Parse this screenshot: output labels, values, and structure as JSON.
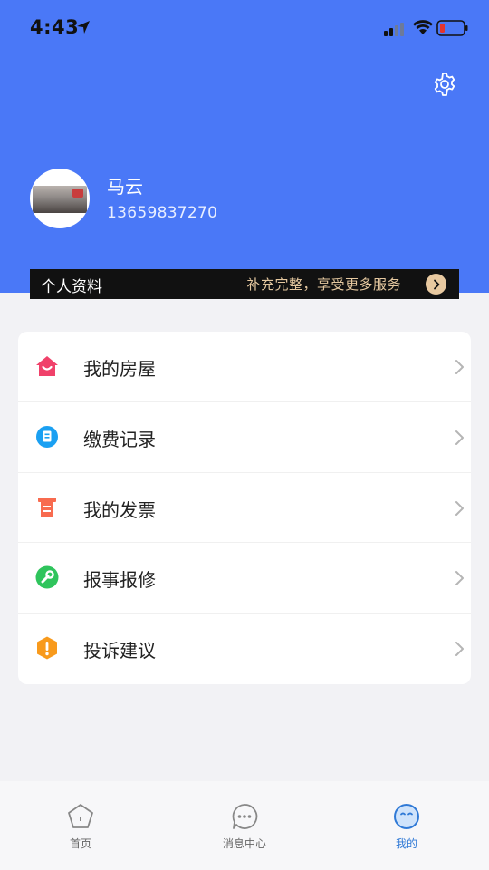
{
  "status_bar": {
    "time": "4:43"
  },
  "user": {
    "name": "马云",
    "phone": "13659837270"
  },
  "profile_banner": {
    "title": "个人资料",
    "tip": "补充完整，享受更多服务"
  },
  "menu": [
    {
      "label": "我的房屋",
      "icon": "house-icon",
      "color": "#f0416a"
    },
    {
      "label": "缴费记录",
      "icon": "bill-icon",
      "color": "#1aa0f2"
    },
    {
      "label": "我的发票",
      "icon": "invoice-icon",
      "color": "#f86b4f"
    },
    {
      "label": "报事报修",
      "icon": "wrench-icon",
      "color": "#2fc45c"
    },
    {
      "label": "投诉建议",
      "icon": "warning-icon",
      "color": "#f89a1c"
    }
  ],
  "tabs": [
    {
      "label": "首页",
      "icon": "home-icon"
    },
    {
      "label": "消息中心",
      "icon": "message-icon"
    },
    {
      "label": "我的",
      "icon": "profile-icon",
      "active": true
    }
  ],
  "colors": {
    "header": "#4a78f7",
    "accent": "#2f79d6",
    "banner_accent": "#e8c9a0"
  }
}
